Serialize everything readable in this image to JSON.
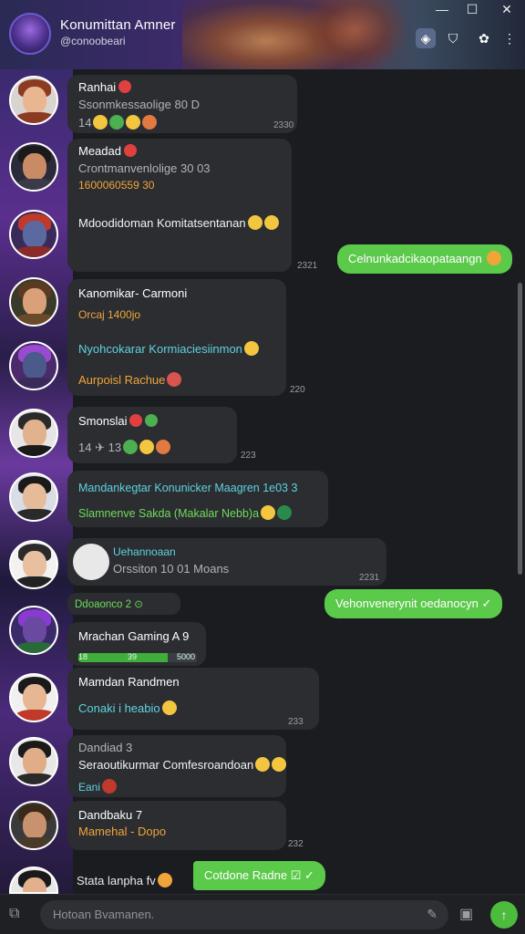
{
  "header": {
    "title": "Konumittan Amner",
    "subtitle": "@conoobeari",
    "window_controls": {
      "minimize": "—",
      "maximize": "☐",
      "close": "✕"
    }
  },
  "messages": [
    {
      "id": "m1",
      "lines": [
        "Ranhai",
        "Ssonmkessaolige 80 D",
        "14"
      ],
      "time": "2330"
    },
    {
      "id": "m2",
      "lines": [
        "Meadad",
        "Crontmanvenlolige 30 03",
        "1600060559 30",
        "Mdoodidoman Komitatsentanan"
      ],
      "time": "2321"
    },
    {
      "id": "m3",
      "lines": [
        "Kanomikar- Carmoni",
        "Orcaj 1400jo",
        "Nyohcokarar Kormiaciesiinmon",
        "Aurpoisl Rachue"
      ],
      "time": "220"
    },
    {
      "id": "m4",
      "lines": [
        "Smonslai",
        "14",
        "13"
      ],
      "time": "223"
    },
    {
      "id": "m5",
      "lines": [
        "Mandankegtar Konunicker Maagren 1e03 3",
        "Slamnenve Sakda (Makalar Nebb)a"
      ]
    },
    {
      "id": "m6",
      "lines": [
        "Uehannoaan",
        "Orssiton 10 01 Moans"
      ],
      "time": "2231"
    },
    {
      "id": "m7",
      "lines": [
        "Ddoaonco 2"
      ]
    },
    {
      "id": "m8",
      "lines": [
        "Mrachan Gaming A 9",
        "18",
        "39",
        "5000"
      ],
      "progress": 0.75
    },
    {
      "id": "m9",
      "lines": [
        "Mamdan Randmen",
        "Conaki i heabio"
      ],
      "time": "233"
    },
    {
      "id": "m10",
      "lines": [
        "Dandiad 3",
        "Seraoutikurmar Comfesroandoan",
        "Eani"
      ],
      "time": ""
    },
    {
      "id": "m11",
      "lines": [
        "Dandbaku 7",
        "Mamehal - Dopo"
      ],
      "time": "232"
    },
    {
      "id": "m12",
      "lines": [
        "Stata lanpha fv"
      ]
    }
  ],
  "outgoing": [
    {
      "id": "o1",
      "text": "Celnunkadcikaopataangn"
    },
    {
      "id": "o2",
      "text": "Vehonvenerynit oedanocyn"
    },
    {
      "id": "o3",
      "text": "Cotdone Radne"
    }
  ],
  "input": {
    "placeholder": "Hotoan Bvamanen."
  },
  "colors": {
    "accent_green": "#5bc94a",
    "bubble": "#2b2d31",
    "teal_text": "#5fd3e0",
    "orange_text": "#f0a53a"
  },
  "icons": [
    "group-avatar",
    "minimize-icon",
    "maximize-icon",
    "close-icon",
    "cube-icon",
    "shield-icon",
    "settings-icon",
    "more-icon",
    "attach-icon",
    "emoji-icon",
    "sticker-icon",
    "send-icon"
  ]
}
